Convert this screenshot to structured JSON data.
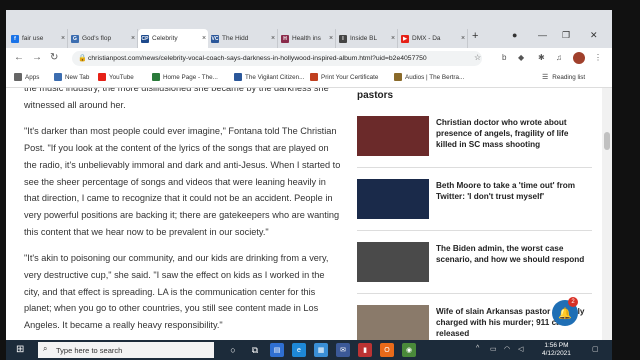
{
  "tabs": [
    {
      "title": "fair use",
      "color": "#1a73e8",
      "letter": "f",
      "active": false
    },
    {
      "title": "God's flop",
      "color": "#3c6db0",
      "letter": "G",
      "active": false
    },
    {
      "title": "Celebrity",
      "color": "#1e4a8c",
      "letter": "CP",
      "active": true
    },
    {
      "title": "The Hidd",
      "color": "#2b579a",
      "letter": "VC",
      "active": false
    },
    {
      "title": "Health ins",
      "color": "#8a2a4a",
      "letter": "H",
      "active": false
    },
    {
      "title": "Inside BL",
      "color": "#444444",
      "letter": "I",
      "active": false
    },
    {
      "title": "DMX - Da",
      "color": "#e62117",
      "letter": "▶",
      "active": false
    }
  ],
  "toolbar": {
    "url": "christianpost.com/news/celebrity-vocal-coach-says-darkness-in-hollywood-inspired-album.html?uid=b2e4057750"
  },
  "bookmarks": {
    "items": [
      {
        "label": "Apps",
        "color": "#666666"
      },
      {
        "label": "New Tab",
        "color": "#3c6db0"
      },
      {
        "label": "YouTube",
        "color": "#e62117"
      },
      {
        "label": "Home Page - The...",
        "color": "#2a7a3a"
      },
      {
        "label": "The Vigilant Citizen...",
        "color": "#2b579a"
      },
      {
        "label": "Print Your Certificate",
        "color": "#c04020"
      },
      {
        "label": "Audios | The Bertra...",
        "color": "#8a6a2a"
      }
    ],
    "reading_list": "Reading list"
  },
  "article": {
    "paragraphs": [
      "the music industry, the more disillusioned she became by the darkness she witnessed all around her.",
      "\"It's darker than most people could ever imagine,\" Fontana told The Christian Post. \"If you look at the content of the lyrics of the songs that are played on the radio, it's unbelievably immoral and dark and anti-Jesus. When I started to see the sheer percentage of songs and videos that were leaning heavily in that direction, I came to recognize that it could not be an accident. People in very powerful positions are backing it; there are gatekeepers who are wanting this content that we hear now to be prevalent in our society.\"",
      "\"It's akin to poisoning our community, and our kids are drinking from a very, very destructive cup,\" she said. \"I saw the effect on kids as I worked in the city, and that effect is spreading. LA is the communication center for this planet; when you go to other countries, you still see content made in Los Angeles. It became a really heavy responsibility.\""
    ]
  },
  "sidebar": {
    "heading": "pastors",
    "items": [
      {
        "title": "Christian doctor who wrote about presence of angels, fragility of life killed in SC mass shooting",
        "thumb": "#6b2a2a"
      },
      {
        "title": "Beth Moore to take a 'time out' from Twitter: 'I don't trust myself'",
        "thumb": "#1a2a4a"
      },
      {
        "title": "The Biden admin, the worst case scenario, and how we should respond",
        "thumb": "#4a4a4a"
      },
      {
        "title": "Wife of slain Arkansas pastor formally charged with his murder; 911 call released",
        "thumb": "#8a7a6a"
      }
    ]
  },
  "notifications": {
    "count": "2"
  },
  "taskbar": {
    "search_placeholder": "Type here to search",
    "time": "1:56 PM",
    "date": "4/12/2021"
  }
}
